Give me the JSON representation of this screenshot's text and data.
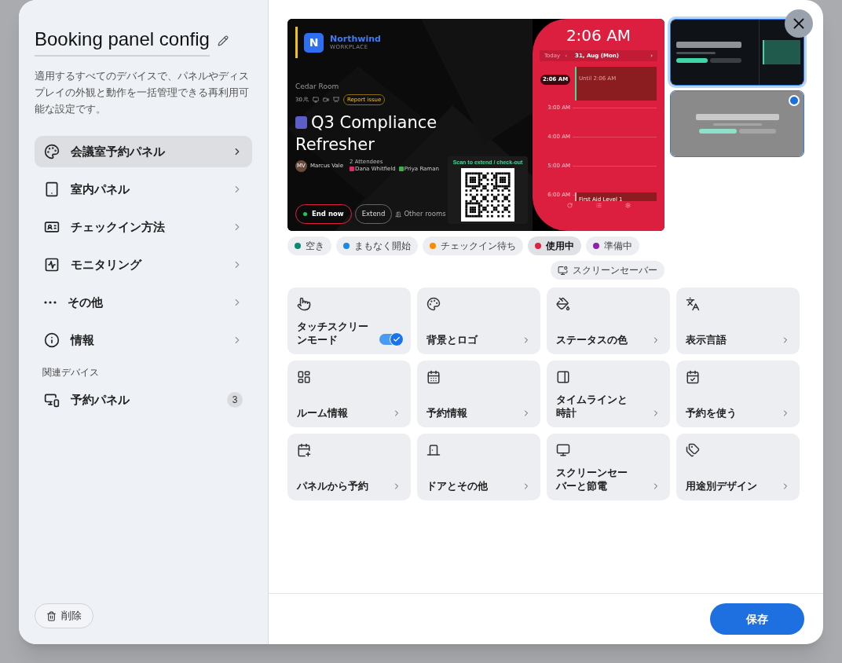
{
  "sidebar": {
    "title": "Booking panel config",
    "description": "適用するすべてのデバイスで、パネルやディスプレイの外観と動作を一括管理できる再利用可能な設定です。",
    "items": [
      {
        "label": "会議室予約パネル",
        "selected": true
      },
      {
        "label": "室内パネル",
        "selected": false
      },
      {
        "label": "チェックイン方法",
        "selected": false
      },
      {
        "label": "モニタリング",
        "selected": false
      },
      {
        "label": "その他",
        "selected": false
      },
      {
        "label": "情報",
        "selected": false
      }
    ],
    "section_label": "関連デバイス",
    "devices": [
      {
        "label": "予約パネル",
        "count": "3"
      }
    ],
    "delete_button": "削除"
  },
  "preview": {
    "logo_letter": "N",
    "brand": "Northwind",
    "brand_sub": "WORKPLACE",
    "room": "Cedar Room",
    "capacity": "30",
    "report_button": "Report issue",
    "meeting_title": "Q3 Compliance Refresher",
    "organizer_initials": "MV",
    "organizer": "Marcus Vale",
    "attendees_label": "2 Attendees",
    "attendees": [
      {
        "name": "Dana Whitfield",
        "color": "#e5266a"
      },
      {
        "name": "Priya Raman",
        "color": "#3db24a"
      }
    ],
    "qr_label": "Scan to extend / check-out",
    "end_button": "End now",
    "extend_button": "Extend",
    "other_rooms_button": "Other rooms",
    "clock": "2:06 AM",
    "today_button": "Today",
    "prev_button": "‹",
    "date": "31, Aug (Mon)",
    "next_button": "›",
    "now_badge": "2:06 AM",
    "current_event": "Until 2:06 AM",
    "hours": [
      "3:00 AM",
      "4:00 AM",
      "5:00 AM",
      "6:00 AM"
    ],
    "next_event": "First Aid Level 1"
  },
  "layouts": [
    {
      "kind": "split",
      "selected": false
    },
    {
      "kind": "centered",
      "selected": true
    }
  ],
  "status_chips": [
    {
      "label": "空き",
      "color": "#0b8a73",
      "selected": false
    },
    {
      "label": "まもなく開始",
      "color": "#1e88e5",
      "selected": false
    },
    {
      "label": "チェックイン待ち",
      "color": "#fb8c00",
      "selected": false
    },
    {
      "label": "使用中",
      "color": "#e0213f",
      "selected": true
    },
    {
      "label": "準備中",
      "color": "#8e24aa",
      "selected": false
    }
  ],
  "screensaver_chip": {
    "label": "スクリーンセーバー",
    "selected": false
  },
  "tiles": [
    {
      "label": "タッチスクリーンモード",
      "kind": "toggle",
      "on": true
    },
    {
      "label": "背景とロゴ",
      "kind": "link"
    },
    {
      "label": "ステータスの色",
      "kind": "link"
    },
    {
      "label": "表示言語",
      "kind": "link"
    },
    {
      "label": "ルーム情報",
      "kind": "link"
    },
    {
      "label": "予約情報",
      "kind": "link"
    },
    {
      "label": "タイムラインと時計",
      "kind": "link"
    },
    {
      "label": "予約を使う",
      "kind": "link"
    },
    {
      "label": "パネルから予約",
      "kind": "link"
    },
    {
      "label": "ドアとその他",
      "kind": "link"
    },
    {
      "label": "スクリーンセーバーと節電",
      "kind": "link"
    },
    {
      "label": "用途別デザイン",
      "kind": "link"
    }
  ],
  "save_button": "保存"
}
